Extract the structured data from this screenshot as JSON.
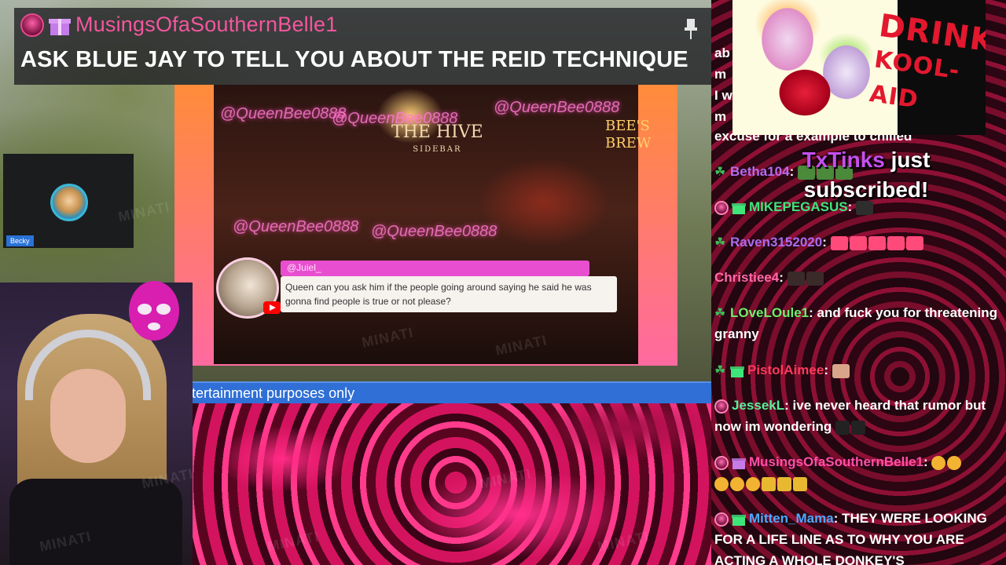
{
  "alert_header": {
    "username": "MusingsOfaSouthernBelle1",
    "message": "ASK BLUE JAY TO TELL YOU ABOUT THE REID TECHNIQUE",
    "username_color": "#f3569e"
  },
  "stream": {
    "neon_handles": [
      "@QueenBee0888",
      "@QueenBee0888",
      "@QueenBee0888",
      "@QueenBee0888",
      "@QueenBee0888"
    ],
    "hive_sign": {
      "title": "THE HIVE",
      "subtitle": "SIDEBAR"
    },
    "bees_sign": [
      "BEE'S",
      "BREW"
    ],
    "comment": {
      "handle": "@Juiel_",
      "text": "Queen can you ask him if the people going around saying he said he was gonna find people is true or not please?"
    },
    "webcam_label": "Becky",
    "ticker": "tertainment purposes only"
  },
  "overlay": {
    "kool_aid_line1": "DRINK",
    "kool_aid_line2": "KOOL-AID",
    "sub_alert_name": "TxTinks",
    "sub_alert_word1": "just",
    "sub_alert_word2": "subscribed!"
  },
  "chat": {
    "partial_lines": [
      "ab",
      "m",
      "I w",
      "m",
      "excuse for a example to chilled"
    ],
    "messages": [
      {
        "name": "Betha104",
        "color": "#b36cf0",
        "badges": [
          "sprout"
        ],
        "text": ""
      },
      {
        "name": "MIKEPEGASUS",
        "color": "#3ee67a",
        "badges": [
          "avatar",
          "gift-green"
        ],
        "text": ""
      },
      {
        "name": "Raven3152020",
        "color": "#a86cf0",
        "badges": [
          "sprout"
        ],
        "text": ""
      },
      {
        "name": "Christiee4",
        "color": "#ff6aa8",
        "badges": [],
        "text": ""
      },
      {
        "name": "LOveLOule1",
        "color": "#6cf06a",
        "badges": [
          "sprout"
        ],
        "text": "and fuck you for threatening granny"
      },
      {
        "name": "PistolAimee",
        "color": "#ff3a5c",
        "badges": [
          "sprout",
          "gift-green"
        ],
        "text": ""
      },
      {
        "name": "JessekL",
        "color": "#59f09a",
        "badges": [
          "avatar"
        ],
        "text": "ive never heard that rumor but now im wondering"
      },
      {
        "name": "MusingsOfaSouthernBelle1",
        "color": "#ff4fa8",
        "badges": [
          "avatar",
          "gift-purple"
        ],
        "text": ""
      },
      {
        "name": "Mitten_Mama",
        "color": "#4fa8ff",
        "badges": [
          "avatar",
          "gift-green"
        ],
        "text": "THEY WERE LOOKING FOR A LIFE LINE AS TO WHY YOU ARE ACTING A WHOLE DONKEY'S"
      }
    ]
  },
  "watermark_text": "MINATI"
}
